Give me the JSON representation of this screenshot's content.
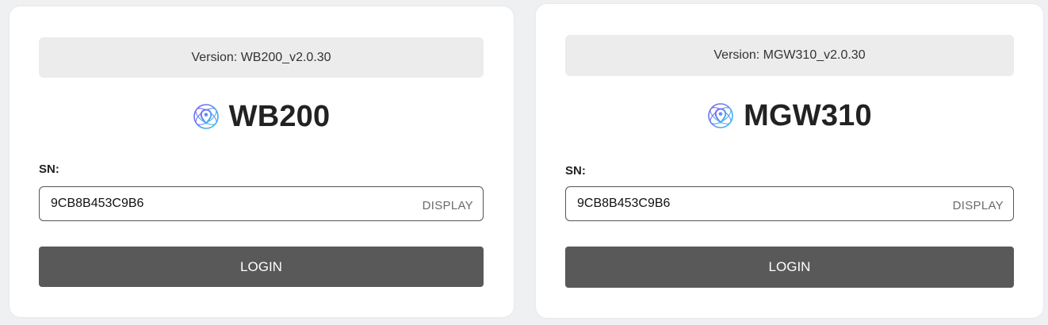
{
  "panels": [
    {
      "version_text": "Version: WB200_v2.0.30",
      "brand_name": "WB200",
      "sn_label": "SN:",
      "sn_value": "9CB8B453C9B6",
      "display_label": "DISPLAY",
      "login_label": "LOGIN"
    },
    {
      "version_text": "Version: MGW310_v2.0.30",
      "brand_name": "MGW310",
      "sn_label": "SN:",
      "sn_value": "9CB8B453C9B6",
      "display_label": "DISPLAY",
      "login_label": "LOGIN"
    }
  ],
  "icons": {
    "brand_logo": "location-pin-network-icon"
  },
  "colors": {
    "page_background": "#eef0f2",
    "card_background": "#ffffff",
    "version_background": "#ececec",
    "login_button": "#595959",
    "logo_gradient_start": "#7b5cf5",
    "logo_gradient_end": "#3ec4f0"
  }
}
